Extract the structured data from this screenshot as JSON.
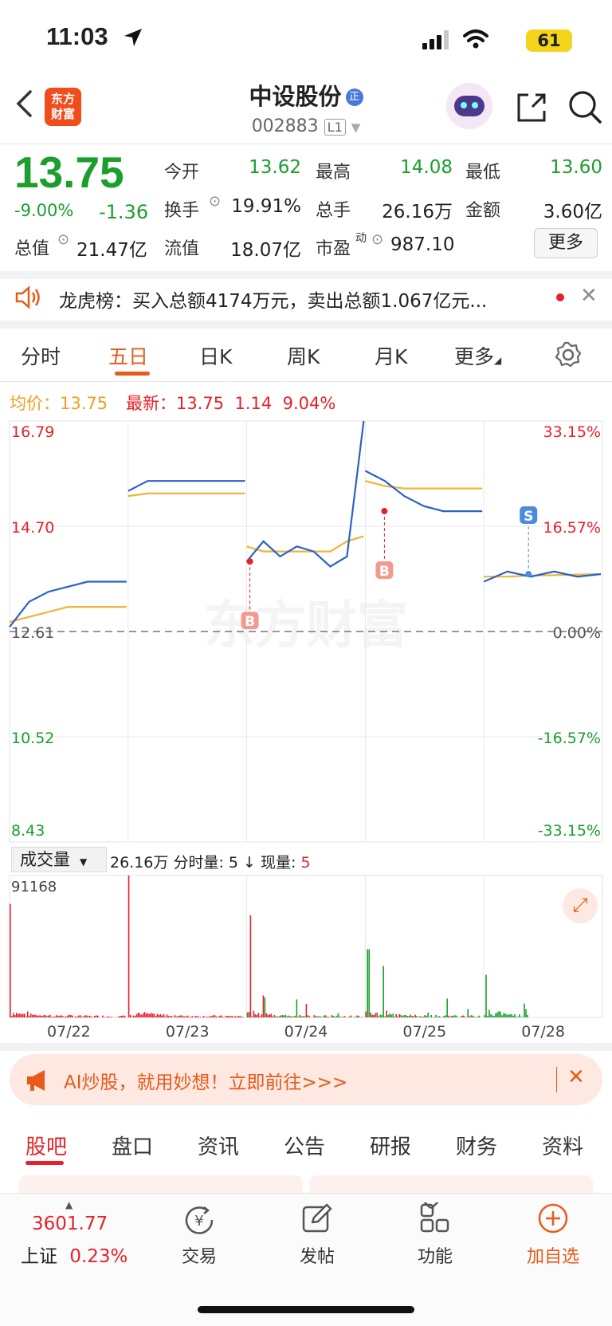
{
  "status_bar": {
    "time": "11:03",
    "battery": "61"
  },
  "nav": {
    "logo_line1": "东方",
    "logo_line2": "财富",
    "title": "中设股份",
    "badge": "正",
    "code": "002883",
    "level": "L1"
  },
  "quote": {
    "price": "13.75",
    "change_pct": "-9.00%",
    "change_amt": "-1.36",
    "open_label": "今开",
    "open": "13.62",
    "high_label": "最高",
    "high": "14.08",
    "low_label": "最低",
    "low": "13.60",
    "turnover_label": "换手",
    "turnover": "19.91%",
    "volume_label": "总手",
    "volume": "26.16万",
    "amount_label": "金额",
    "amount": "3.60亿",
    "mktcap_label": "总值",
    "mktcap": "21.47亿",
    "float_label": "流值",
    "float_cap": "18.07亿",
    "pe_label": "市盈",
    "pe_sup": "动",
    "pe": "987.10",
    "more_label": "更多"
  },
  "notice": {
    "text": "龙虎榜：买入总额4174万元，卖出总额1.067亿元..."
  },
  "tabs": [
    "分时",
    "五日",
    "日K",
    "周K",
    "月K",
    "更多"
  ],
  "active_tab": "五日",
  "legend": {
    "avg_label": "均价：",
    "avg": "13.75",
    "latest_label": "最新：",
    "latest": "13.75",
    "latest_chg": "1.14",
    "latest_pct": "9.04%"
  },
  "chart_data": {
    "type": "line",
    "y_left_ticks": [
      "16.79",
      "14.70",
      "12.61",
      "10.52",
      "8.43"
    ],
    "y_right_ticks": [
      "33.15%",
      "16.57%",
      "0.00%",
      "-16.57%",
      "-33.15%"
    ],
    "ylim": [
      8.43,
      16.79
    ],
    "baseline": 12.61,
    "x_dates": [
      "07/22",
      "07/23",
      "07/24",
      "07/25",
      "07/28"
    ],
    "series": [
      {
        "name": "最新",
        "color": "#2a62c9",
        "values": [
          [
            12.7,
            13.2,
            13.4,
            13.5,
            13.6,
            13.6,
            13.6
          ],
          [
            15.4,
            15.6,
            15.6,
            15.6,
            15.6,
            15.6,
            15.6
          ],
          [
            14.0,
            14.4,
            14.1,
            14.3,
            14.2,
            13.9,
            14.1,
            16.79
          ],
          [
            15.8,
            15.6,
            15.3,
            15.1,
            15.0,
            15.0,
            15.0
          ],
          [
            13.6,
            13.8,
            13.7,
            13.8,
            13.7,
            13.75
          ]
        ]
      },
      {
        "name": "均价",
        "color": "#f0b43a",
        "values": [
          [
            12.8,
            12.9,
            13.0,
            13.1,
            13.1,
            13.1,
            13.1
          ],
          [
            15.3,
            15.35,
            15.35,
            15.35,
            15.35,
            15.35,
            15.35
          ],
          [
            14.3,
            14.2,
            14.2,
            14.2,
            14.2,
            14.2,
            14.4,
            14.5
          ],
          [
            15.6,
            15.5,
            15.45,
            15.45,
            15.45,
            15.45,
            15.45
          ],
          [
            13.7,
            13.7,
            13.72,
            13.73,
            13.74,
            13.75
          ]
        ]
      }
    ],
    "markers": [
      "B",
      "B",
      "S"
    ],
    "watermark": "东方财富"
  },
  "volume": {
    "label": "成交量",
    "total": "26.16万",
    "tick_label": "分时量: 5",
    "current_label": "现量:",
    "current": "5",
    "max": "91168"
  },
  "ai_banner": {
    "text": "AI炒股，就用妙想！立即前往>>>"
  },
  "bottom_tabs": [
    "股吧",
    "盘口",
    "资讯",
    "公告",
    "研报",
    "财务",
    "资料"
  ],
  "bottom_bar": {
    "index_value": "3601.77",
    "index_name": "上证",
    "index_pct": "0.23%",
    "trade": "交易",
    "post": "发帖",
    "func": "功能",
    "add": "加自选"
  }
}
